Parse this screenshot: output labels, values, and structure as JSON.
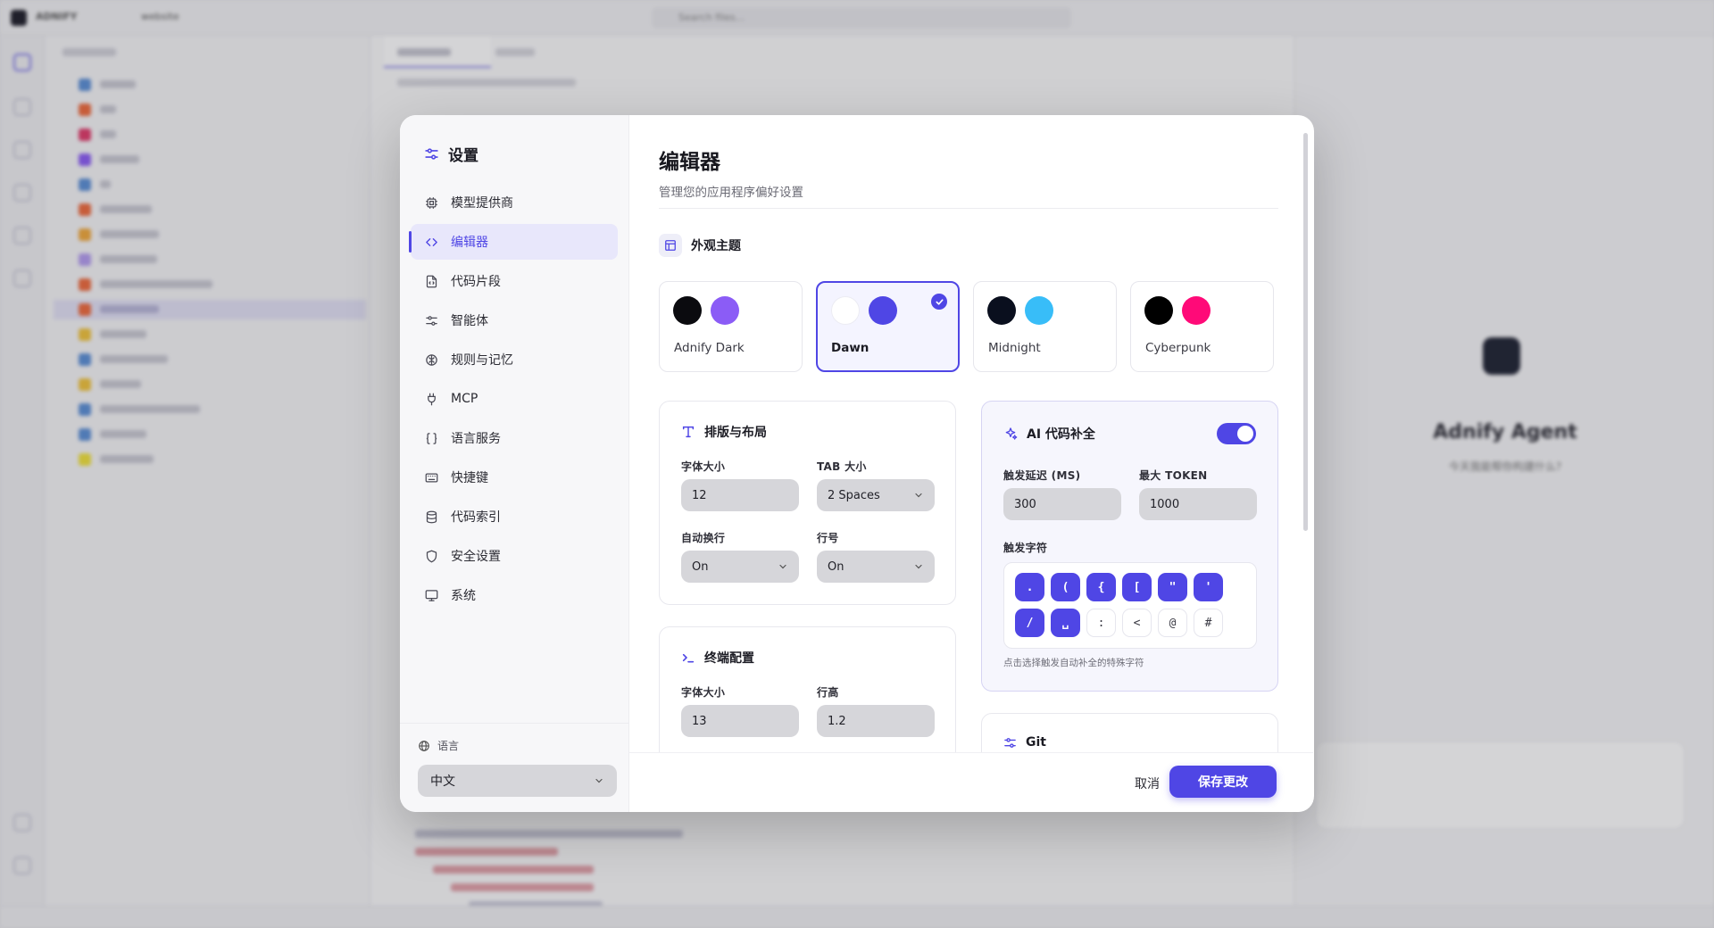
{
  "background": {
    "app_name": "ADNIFY",
    "workspace": "website",
    "search_placeholder": "Search files...",
    "tabs": [
      "index.html",
      "style.css"
    ],
    "files": [
      "adnify",
      ".git",
      "src",
      "images",
      "js",
      ".gitignore",
      "favicon.svg",
      "image.png",
      "index_optimized.html",
      "index.html",
      "LICENSE",
      "README.md",
      "script.js",
      "styles_optimized.css",
      "styles.css",
      "vercel.json"
    ],
    "agent_title": "Adnify Agent",
    "agent_subtitle": "今天我能帮你构建什么?"
  },
  "sidebar": {
    "title": "设置",
    "items": [
      {
        "label": "模型提供商",
        "icon": "cpu-icon"
      },
      {
        "label": "编辑器",
        "icon": "code-icon"
      },
      {
        "label": "代码片段",
        "icon": "file-code-icon"
      },
      {
        "label": "智能体",
        "icon": "sliders-icon"
      },
      {
        "label": "规则与记忆",
        "icon": "brain-icon"
      },
      {
        "label": "MCP",
        "icon": "plug-icon"
      },
      {
        "label": "语言服务",
        "icon": "braces-icon"
      },
      {
        "label": "快捷键",
        "icon": "keyboard-icon"
      },
      {
        "label": "代码索引",
        "icon": "database-icon"
      },
      {
        "label": "安全设置",
        "icon": "shield-icon"
      },
      {
        "label": "系统",
        "icon": "monitor-icon"
      }
    ],
    "active_index": 1,
    "language_label": "语言",
    "language_value": "中文"
  },
  "header": {
    "title": "编辑器",
    "subtitle": "管理您的应用程序偏好设置"
  },
  "theme": {
    "section_title": "外观主题",
    "options": [
      {
        "name": "Adnify Dark",
        "colors": [
          "#0b0b0f",
          "#8b5cf6"
        ]
      },
      {
        "name": "Dawn",
        "colors": [
          "#ffffff",
          "#4f46e5"
        ],
        "selected": true
      },
      {
        "name": "Midnight",
        "colors": [
          "#0a0f1e",
          "#38bdf8"
        ]
      },
      {
        "name": "Cyberpunk",
        "colors": [
          "#000000",
          "#ff0a78"
        ]
      }
    ]
  },
  "typography": {
    "title": "排版与布局",
    "font_size_label": "字体大小",
    "font_size_value": "12",
    "tab_size_label": "TAB 大小",
    "tab_size_value": "2 Spaces",
    "word_wrap_label": "自动换行",
    "word_wrap_value": "On",
    "line_numbers_label": "行号",
    "line_numbers_value": "On"
  },
  "terminal": {
    "title": "终端配置",
    "font_size_label": "字体大小",
    "font_size_value": "13",
    "line_height_label": "行高",
    "line_height_value": "1.2"
  },
  "ai": {
    "title": "AI 代码补全",
    "enabled": true,
    "delay_label": "触发延迟 (MS)",
    "delay_value": "300",
    "max_token_label": "最大 TOKEN",
    "max_token_value": "1000",
    "trigger_label": "触发字符",
    "triggers": [
      {
        "char": ".",
        "on": true
      },
      {
        "char": "(",
        "on": true
      },
      {
        "char": "{",
        "on": true
      },
      {
        "char": "[",
        "on": true
      },
      {
        "char": "\"",
        "on": true
      },
      {
        "char": "'",
        "on": true
      },
      {
        "char": "/",
        "on": true
      },
      {
        "char": "␣",
        "on": true
      },
      {
        "char": ":",
        "on": false
      },
      {
        "char": "<",
        "on": false
      },
      {
        "char": "@",
        "on": false
      },
      {
        "char": "#",
        "on": false
      }
    ],
    "hint": "点击选择触发自动补全的特殊字符"
  },
  "git": {
    "title": "Git"
  },
  "footer": {
    "cancel_label": "取消",
    "save_label": "保存更改"
  },
  "colors": {
    "accent": "#4f46e5",
    "accent_soft": "#e8e7fb"
  }
}
